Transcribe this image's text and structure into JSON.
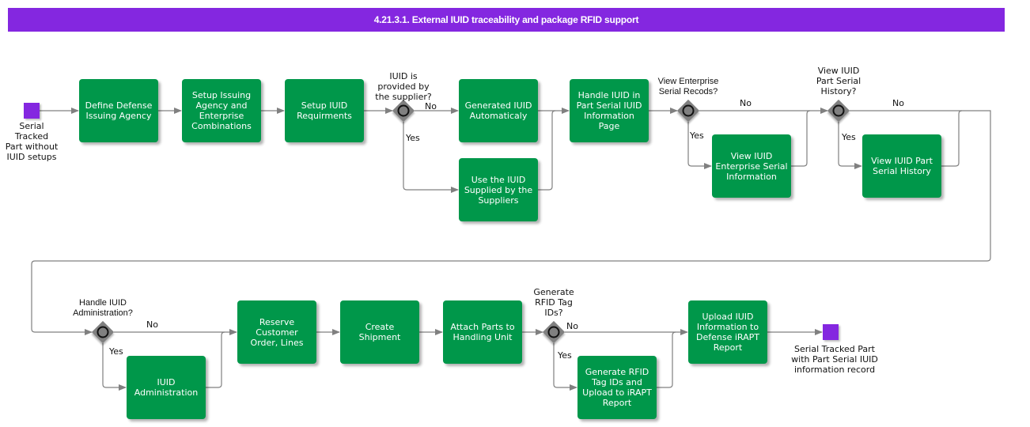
{
  "title": "4.21.3.1. External IUID traceability and package RFID support",
  "colors": {
    "title_bg": "#8427e0",
    "task": "#00974a",
    "event": "#8427e0",
    "gateway": "#808080",
    "line": "#808080"
  },
  "start_event": {
    "label": "Serial\nTracked\nPart without\nIUID setups"
  },
  "end_event": {
    "label": "Serial Tracked Part\nwith Part Serial IUID\ninformation record"
  },
  "tasks": {
    "define_agency": "Define Defense\nIssuing Agency",
    "setup_agency": "Setup Issuing\nAgency and\nEnterprise\nCombinations",
    "setup_iuid": "Setup IUID\nRequirments",
    "generated_iuid": "Generated IUID\nAutomaticaly",
    "use_supplied": "Use the IUID\nSupplied by the\nSuppliers",
    "handle_iuid": "Handle IUID in\nPart Serial IUID\nInformation\nPage",
    "view_enterprise": "View IUID\nEnterprise Serial\nInformation",
    "view_history": "View IUID Part\nSerial History",
    "iuid_admin": "IUID\nAdministration",
    "reserve_order": "Reserve\nCustomer\nOrder, Lines",
    "create_shipment": "Create\nShipment",
    "attach_parts": "Attach Parts to\nHandling Unit",
    "generate_rfid": "Generate RFID\nTag IDs and\nUpload to iRAPT\nReport",
    "upload_iuid": "Upload IUID\nInformation to\nDefense iRAPT\nReport"
  },
  "gateways": {
    "supplier": "IUID is\nprovided by\nthe supplier?",
    "enterprise": "View Enterprise\nSerial Recods?",
    "history": "View IUID\nPart Serial\nHistory?",
    "admin": "Handle IUID\nAdministration?",
    "rfid": "Generate\nRFID Tag\nIDs?"
  },
  "flow_labels": {
    "yes": "Yes",
    "no": "No"
  }
}
